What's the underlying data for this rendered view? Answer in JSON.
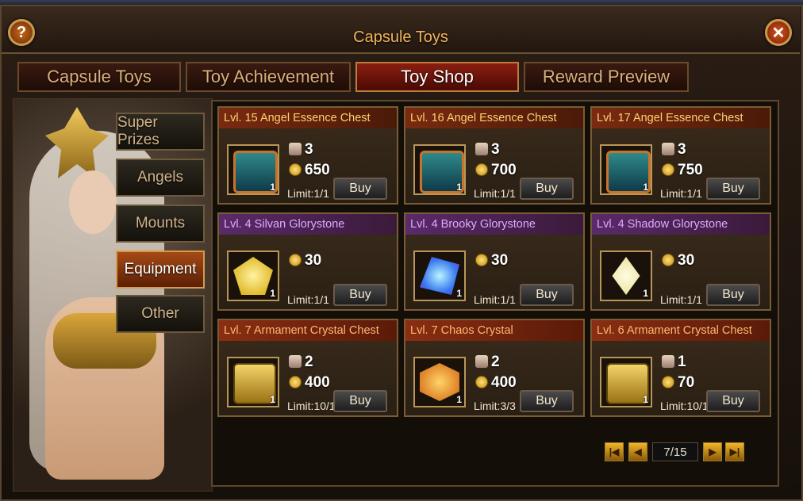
{
  "window": {
    "title": "Capsule Toys"
  },
  "tabs": [
    {
      "label": "Capsule Toys",
      "active": false
    },
    {
      "label": "Toy Achievement",
      "active": false
    },
    {
      "label": "Toy Shop",
      "active": true
    },
    {
      "label": "Reward Preview",
      "active": false
    }
  ],
  "categories": [
    {
      "label": "Super Prizes",
      "active": false
    },
    {
      "label": "Angels",
      "active": false
    },
    {
      "label": "Mounts",
      "active": false
    },
    {
      "label": "Equipment",
      "active": true
    },
    {
      "label": "Other",
      "active": false
    }
  ],
  "items": [
    {
      "name": "Lvl. 15 Angel Essence Chest",
      "head": "orange",
      "qty": "1",
      "scrolls": "3",
      "price": "650",
      "limit": "Limit:1/1",
      "buy": "Buy",
      "icon": "chest-icon"
    },
    {
      "name": "Lvl. 16 Angel Essence Chest",
      "head": "orange",
      "qty": "1",
      "scrolls": "3",
      "price": "700",
      "limit": "Limit:1/1",
      "buy": "Buy",
      "icon": "chest-icon"
    },
    {
      "name": "Lvl. 17 Angel Essence Chest",
      "head": "orange",
      "qty": "1",
      "scrolls": "3",
      "price": "750",
      "limit": "Limit:1/1",
      "buy": "Buy",
      "icon": "chest-icon"
    },
    {
      "name": "Lvl. 4 Silvan Glorystone",
      "head": "purple",
      "qty": "1",
      "scrolls": null,
      "price": "30",
      "limit": "Limit:1/1",
      "buy": "Buy",
      "icon": "yellow-gem-icon"
    },
    {
      "name": "Lvl. 4 Brooky Glorystone",
      "head": "purple",
      "qty": "1",
      "scrolls": null,
      "price": "30",
      "limit": "Limit:1/1",
      "buy": "Buy",
      "icon": "blue-gem-icon"
    },
    {
      "name": "Lvl. 4 Shadow Glorystone",
      "head": "purple",
      "qty": "1",
      "scrolls": null,
      "price": "30",
      "limit": "Limit:1/1",
      "buy": "Buy",
      "icon": "white-gem-icon"
    },
    {
      "name": "Lvl. 7 Armament Crystal Chest",
      "head": "red",
      "qty": "1",
      "scrolls": "2",
      "price": "400",
      "limit": "Limit:10/10",
      "buy": "Buy",
      "icon": "gold-chest-icon"
    },
    {
      "name": "Lvl. 7 Chaos Crystal",
      "head": "red",
      "qty": "1",
      "scrolls": "2",
      "price": "400",
      "limit": "Limit:3/3",
      "buy": "Buy",
      "icon": "chaos-crystal-icon"
    },
    {
      "name": "Lvl. 6 Armament Crystal Chest",
      "head": "red",
      "qty": "1",
      "scrolls": "1",
      "price": "70",
      "limit": "Limit:10/10",
      "buy": "Buy",
      "icon": "gold-chest-icon"
    }
  ],
  "pagination": {
    "text": "7/15"
  },
  "colors": {
    "accent": "#f0b35a",
    "active_tab": "#8b1e10",
    "active_category": "#a54a14"
  }
}
